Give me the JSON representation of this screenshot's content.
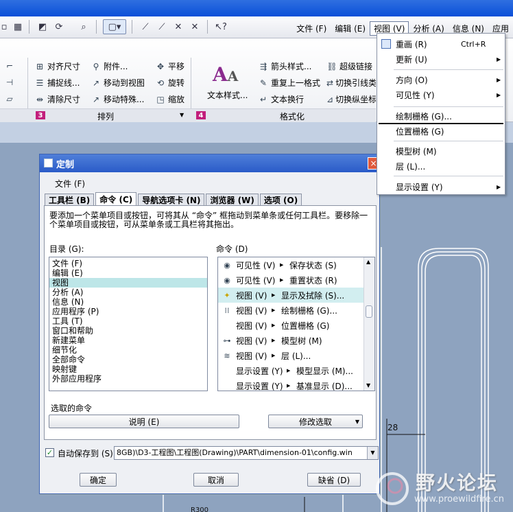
{
  "menubar": {
    "items": [
      "文件 (F)",
      "编辑 (E)",
      "视图 (V)",
      "分析 (A)",
      "信息 (N)",
      "应用"
    ]
  },
  "ribbon": {
    "group3": {
      "num": "3",
      "label": "排列",
      "items": [
        "对齐尺寸",
        "附件...",
        "平移",
        "捕捉线...",
        "移动到视图",
        "旋转",
        "清除尺寸",
        "移动特殊...",
        "缩放"
      ]
    },
    "group4": {
      "num": "4",
      "label": "格式化",
      "text_style": "文本样式...",
      "items": [
        "箭头样式...",
        "超级链接",
        "重复上一格式",
        "切换引线类",
        "文本换行",
        "切换纵坐标"
      ]
    }
  },
  "view_menu": {
    "items": [
      {
        "label": "重画 (R)",
        "shortcut": "Ctrl+R"
      },
      {
        "label": "更新 (U)"
      },
      {
        "label": "方向 (O)"
      },
      {
        "label": "可见性 (Y)"
      },
      {
        "label": "绘制栅格 (G)..."
      },
      {
        "label": "位置栅格 (G)"
      },
      {
        "label": "模型树 (M)"
      },
      {
        "label": "层 (L)..."
      },
      {
        "label": "显示设置 (Y)"
      }
    ]
  },
  "dialog": {
    "title": "定制",
    "close": "×",
    "menu_file": "文件 (F)",
    "tabs": [
      "工具栏 (B)",
      "命令 (C)",
      "导航选项卡 (N)",
      "浏览器 (W)",
      "选项 (O)"
    ],
    "description": "要添加一个菜单项目或按钮，可将其从 “命令” 框拖动到菜单条或任何工具栏。要移除一个菜单项目或按钮，可从菜单条或工具栏将其拖出。",
    "categories_label": "目录 (G):",
    "categories": [
      "文件 (F)",
      "编辑 (E)",
      "视图",
      "分析 (A)",
      "信息 (N)",
      "应用程序 (P)",
      "工具 (T)",
      "窗口和帮助",
      "新建菜单",
      "细节化",
      "全部命令",
      "映射键",
      "外部应用程序"
    ],
    "commands_label": "命令 (D)",
    "commands": [
      {
        "a": "可见性 (V)",
        "b": "保存状态 (S)"
      },
      {
        "a": "可见性 (V)",
        "b": "重置状态 (R)"
      },
      {
        "a": "视图 (V)",
        "b": "显示及拭除 (S)..."
      },
      {
        "a": "视图 (V)",
        "b": "绘制栅格 (G)..."
      },
      {
        "a": "视图 (V)",
        "b": "位置栅格 (G)"
      },
      {
        "a": "视图 (V)",
        "b": "模型树 (M)"
      },
      {
        "a": "视图 (V)",
        "b": "层 (L)..."
      },
      {
        "a": "显示设置 (Y)",
        "b": "模型显示 (M)..."
      },
      {
        "a": "显示设置 (Y)",
        "b": "基准显示 (D)..."
      }
    ],
    "selected_command_label": "选取的命令",
    "describe_button": "说明 (E)",
    "modify_button": "修改选取",
    "autosave_label": "自动保存到 (S)",
    "autosave_path": "8GB)\\D3-工程图\\工程图(Drawing)\\PART\\dimension-01\\config.win",
    "ok": "确定",
    "cancel": "取消",
    "default": "缺省 (D)"
  },
  "drawing": {
    "dim_28": "28",
    "dim_r": "R300"
  },
  "watermark": {
    "title": "野火论坛",
    "url": "www.proewildfire.cn"
  }
}
